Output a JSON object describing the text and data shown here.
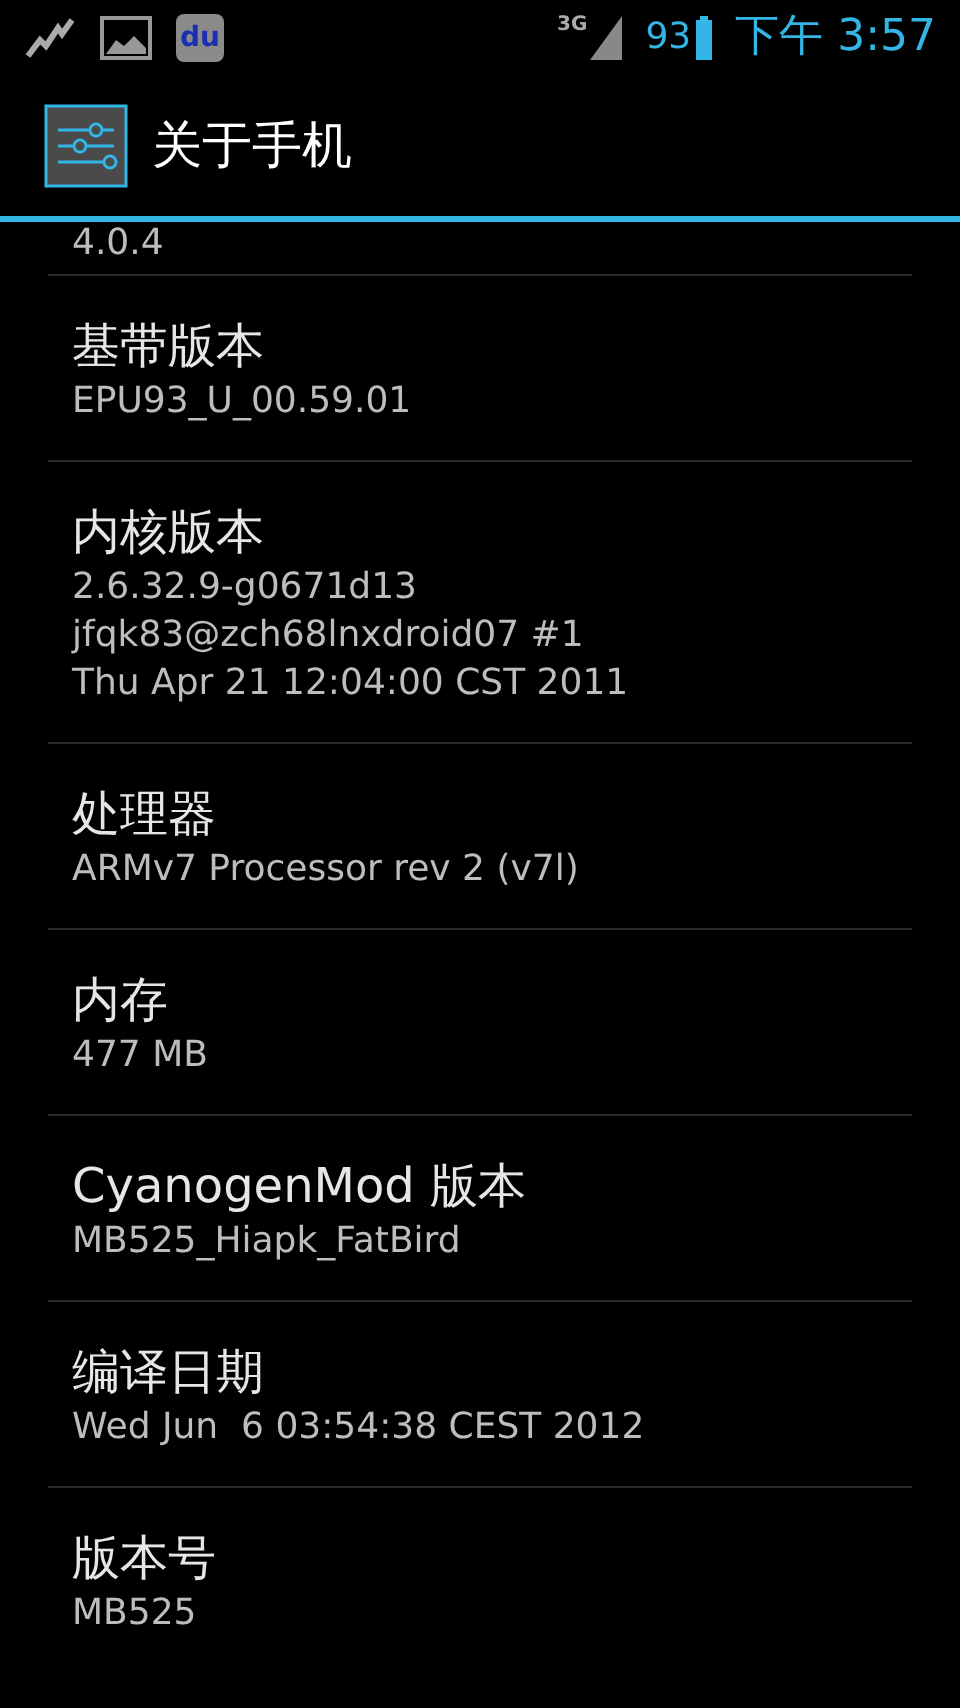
{
  "status_bar": {
    "app_badge": "du",
    "network": "3G",
    "battery": "93",
    "time": "下午 3:57"
  },
  "header": {
    "title": "关于手机"
  },
  "list": {
    "partial_summary": "4.0.4",
    "items": [
      {
        "title": "基带版本",
        "summary": [
          "EPU93_U_00.59.01"
        ]
      },
      {
        "title": "内核版本",
        "summary": [
          "2.6.32.9-g0671d13",
          "jfqk83@zch68lnxdroid07 #1",
          "Thu Apr 21 12:04:00 CST 2011"
        ]
      },
      {
        "title": "处理器",
        "summary": [
          "ARMv7 Processor rev 2 (v7l)"
        ]
      },
      {
        "title": "内存",
        "summary": [
          "477 MB"
        ]
      },
      {
        "title": "CyanogenMod 版本",
        "summary": [
          "MB525_Hiapk_FatBird"
        ]
      },
      {
        "title": "编译日期",
        "summary": [
          "Wed Jun  6 03:54:38 CEST 2012"
        ]
      },
      {
        "title": "版本号",
        "summary": [
          "MB525"
        ]
      }
    ]
  }
}
